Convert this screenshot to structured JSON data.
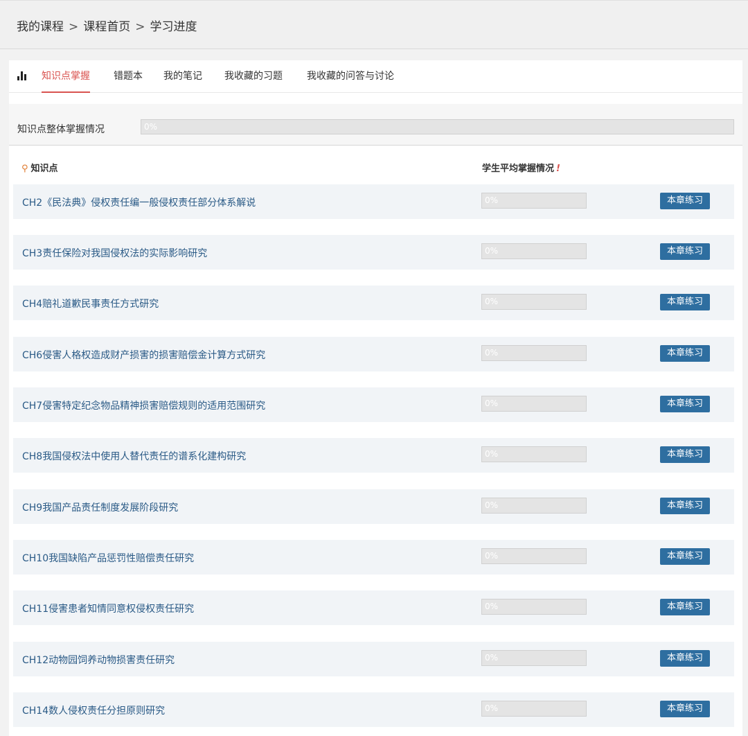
{
  "breadcrumb": [
    "我的课程",
    "课程首页",
    "学习进度"
  ],
  "breadcrumb_sep": ">",
  "tabs": [
    {
      "label": "知识点掌握",
      "active": true
    },
    {
      "label": "错题本",
      "active": false
    },
    {
      "label": "我的笔记",
      "active": false
    },
    {
      "label": "我收藏的习题",
      "active": false
    },
    {
      "label": "我收藏的问答与讨论",
      "active": false
    }
  ],
  "overall": {
    "label": "知识点整体掌握情况",
    "value": "0%",
    "progress": 0
  },
  "list_header": {
    "knowledge_point": "知识点",
    "avg_mastery": "学生平均掌握情况",
    "warn_mark": "!"
  },
  "button_label": "本章练习",
  "rows": [
    {
      "title": "CH2《民法典》侵权责任编一般侵权责任部分体系解说",
      "value": "0%",
      "progress": 0
    },
    {
      "title": "CH3责任保险对我国侵权法的实际影响研究",
      "value": "0%",
      "progress": 0
    },
    {
      "title": "CH4赔礼道歉民事责任方式研究",
      "value": "0%",
      "progress": 0
    },
    {
      "title": "CH6侵害人格权造成财产损害的损害赔偿金计算方式研究",
      "value": "0%",
      "progress": 0
    },
    {
      "title": "CH7侵害特定纪念物品精神损害赔偿规则的适用范围研究",
      "value": "0%",
      "progress": 0
    },
    {
      "title": "CH8我国侵权法中使用人替代责任的谱系化建构研究",
      "value": "0%",
      "progress": 0
    },
    {
      "title": "CH9我国产品责任制度发展阶段研究",
      "value": "0%",
      "progress": 0
    },
    {
      "title": "CH10我国缺陷产品惩罚性赔偿责任研究",
      "value": "0%",
      "progress": 0
    },
    {
      "title": "CH11侵害患者知情同意权侵权责任研究",
      "value": "0%",
      "progress": 0
    },
    {
      "title": "CH12动物园饲养动物损害责任研究",
      "value": "0%",
      "progress": 0
    },
    {
      "title": "CH14数人侵权责任分担原则研究",
      "value": "0%",
      "progress": 0
    }
  ],
  "colors": {
    "active_tab": "#d9534f",
    "link": "#2a5a86",
    "button": "#2e6ea0",
    "row_bg": "#f1f4f7"
  },
  "icons": {
    "tab_icon": "bar-chart-icon",
    "header_icon": "key-icon",
    "warn_icon": "exclamation-icon"
  }
}
